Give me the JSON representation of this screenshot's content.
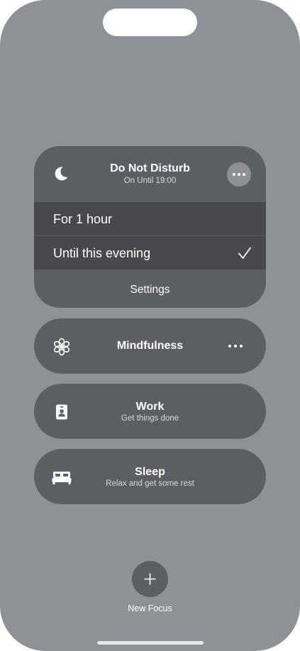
{
  "dnd": {
    "title": "Do Not Disturb",
    "subtitle": "On Until 19:00",
    "icon": "moon-icon",
    "more_icon": "ellipsis-icon",
    "options": [
      {
        "label": "For 1 hour",
        "selected": false
      },
      {
        "label": "Until this evening",
        "selected": true
      }
    ],
    "settings_label": "Settings"
  },
  "focus_modes": [
    {
      "title": "Mindfulness",
      "subtitle": "",
      "icon": "flower-icon",
      "has_more": true
    },
    {
      "title": "Work",
      "subtitle": "Get things done",
      "icon": "id-badge-icon",
      "has_more": false
    },
    {
      "title": "Sleep",
      "subtitle": "Relax and get some rest",
      "icon": "bed-icon",
      "has_more": false
    }
  ],
  "new_focus": {
    "label": "New Focus",
    "icon": "plus-icon"
  },
  "colors": {
    "background": "#8e9196",
    "card": "#5b5e62",
    "option_row": "#47494d"
  }
}
